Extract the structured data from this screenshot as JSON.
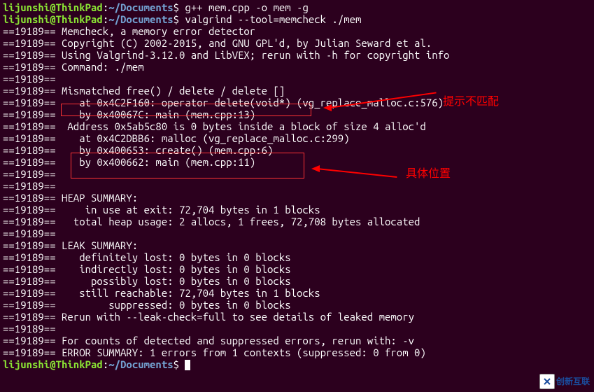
{
  "prompt": {
    "user": "lijunshi",
    "at": "@",
    "host": "ThinkPad",
    "colon": ":",
    "path": "~/Documents",
    "dollar": "$"
  },
  "commands": {
    "cmd1": "g++ mem.cpp -o mem -g",
    "cmd2": "valgrind --tool=memcheck ./mem"
  },
  "output": {
    "l01": "==19189== Memcheck, a memory error detector",
    "l02": "==19189== Copyright (C) 2002-2015, and GNU GPL'd, by Julian Seward et al.",
    "l03": "==19189== Using Valgrind-3.12.0 and LibVEX; rerun with -h for copyright info",
    "l04": "==19189== Command: ./mem",
    "l05": "==19189== ",
    "l06": "==19189== Mismatched free() / delete / delete []",
    "l07": "==19189==    at 0x4C2F160: operator delete(void*) (vg_replace_malloc.c:576)",
    "l08": "==19189==    by 0x40067C: main (mem.cpp:13)",
    "l09": "==19189==  Address 0x5ab5c80 is 0 bytes inside a block of size 4 alloc'd",
    "l10": "==19189==    at 0x4C2DBB6: malloc (vg_replace_malloc.c:299)",
    "l11": "==19189==    by 0x400653: create() (mem.cpp:6)",
    "l12": "==19189==    by 0x400662: main (mem.cpp:11)",
    "l13": "==19189== ",
    "l14": "==19189== ",
    "l15": "==19189== HEAP SUMMARY:",
    "l16": "==19189==     in use at exit: 72,704 bytes in 1 blocks",
    "l17": "==19189==   total heap usage: 2 allocs, 1 frees, 72,708 bytes allocated",
    "l18": "==19189== ",
    "l19": "==19189== LEAK SUMMARY:",
    "l20": "==19189==    definitely lost: 0 bytes in 0 blocks",
    "l21": "==19189==    indirectly lost: 0 bytes in 0 blocks",
    "l22": "==19189==      possibly lost: 0 bytes in 0 blocks",
    "l23": "==19189==    still reachable: 72,704 bytes in 1 blocks",
    "l24": "==19189==         suppressed: 0 bytes in 0 blocks",
    "l25": "==19189== Rerun with --leak-check=full to see details of leaked memory",
    "l26": "==19189== ",
    "l27": "==19189== For counts of detected and suppressed errors, rerun with: -v",
    "l28": "==19189== ERROR SUMMARY: 1 errors from 1 contexts (suppressed: 0 from 0)"
  },
  "annotations": {
    "label1": "提示不匹配",
    "label2": "具体位置"
  },
  "watermark": {
    "text": "创新互联"
  }
}
